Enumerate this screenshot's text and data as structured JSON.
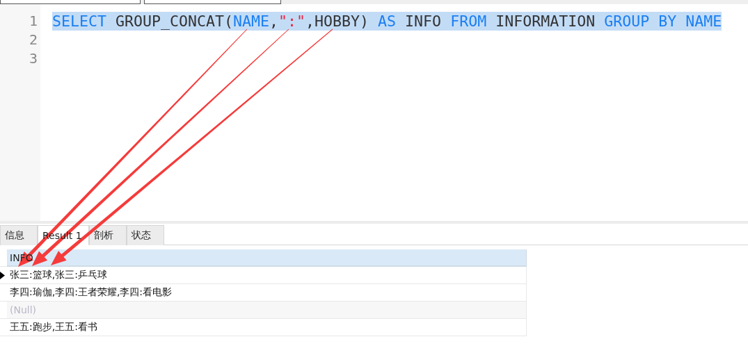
{
  "editor": {
    "lines": [
      {
        "number": "1",
        "selected": true,
        "tokens": [
          {
            "text": "SELECT",
            "kind": "keyword"
          },
          {
            "text": " GROUP_CONCAT(",
            "kind": "plain"
          },
          {
            "text": "NAME",
            "kind": "keyword"
          },
          {
            "text": ",",
            "kind": "plain"
          },
          {
            "text": "\":\"",
            "kind": "string"
          },
          {
            "text": ",HOBBY) ",
            "kind": "plain"
          },
          {
            "text": "AS",
            "kind": "keyword"
          },
          {
            "text": " INFO ",
            "kind": "plain"
          },
          {
            "text": "FROM",
            "kind": "keyword"
          },
          {
            "text": " INFORMATION ",
            "kind": "plain"
          },
          {
            "text": "GROUP BY NAME",
            "kind": "keyword"
          }
        ]
      },
      {
        "number": "2",
        "selected": false
      },
      {
        "number": "3",
        "selected": false
      }
    ]
  },
  "result_tabs": [
    {
      "label": "信息",
      "selected": false
    },
    {
      "label": "Result 1",
      "selected": true
    },
    {
      "label": "剖析",
      "selected": false
    },
    {
      "label": "状态",
      "selected": false
    }
  ],
  "table": {
    "columns": [
      "INFO"
    ],
    "rows": [
      {
        "value": "张三:篮球,张三:乒乓球",
        "selected": true,
        "is_null": false
      },
      {
        "value": "李四:瑜伽,李四:王者荣耀,李四:看电影",
        "selected": false,
        "is_null": false
      },
      {
        "value": "(Null)",
        "selected": false,
        "is_null": true
      },
      {
        "value": "王五:跑步,王五:看书",
        "selected": false,
        "is_null": false
      }
    ]
  }
}
